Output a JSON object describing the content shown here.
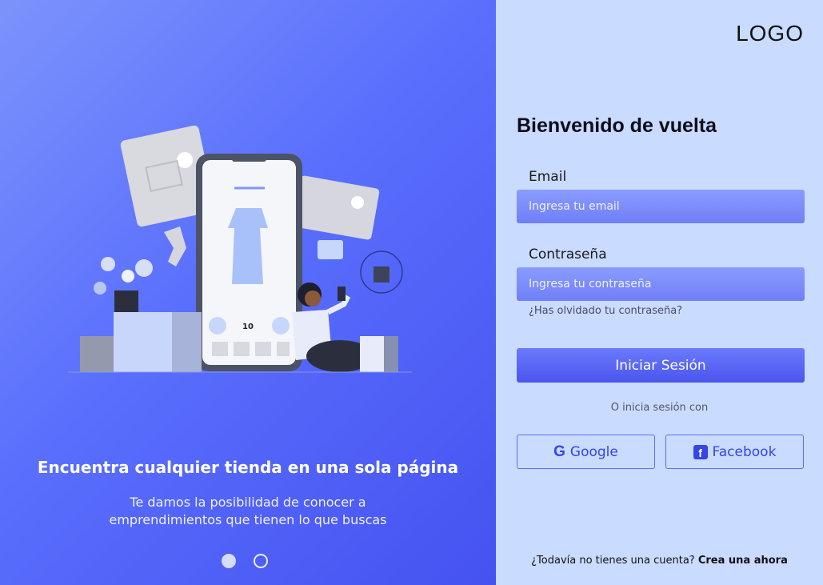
{
  "hero": {
    "title": "Encuentra cualquier tienda en una sola página",
    "subtitle_line1": "Te damos la posibilidad de conocer a",
    "subtitle_line2": "emprendimientos que tienen lo que buscas",
    "slides": 2,
    "active_slide": 1
  },
  "header": {
    "logo": "LOGO"
  },
  "form": {
    "title": "Bienvenido de vuelta",
    "email_label": "Email",
    "email_placeholder": "Ingresa tu email",
    "password_label": "Contraseña",
    "password_placeholder": "Ingresa tu contraseña",
    "forgot": "¿Has olvidado tu contraseña?",
    "submit": "Iniciar Sesión",
    "or_text": "O inicia sesión con",
    "google": "Google",
    "facebook": "Facebook",
    "signup_prompt": "¿Todavía no tienes una cuenta?",
    "signup_link": "Crea una ahora"
  },
  "illustration": {
    "price_label": "10"
  },
  "colors": {
    "accent": "#5a6ffd",
    "panel": "#c9dbff",
    "button": "#4a55ee"
  }
}
